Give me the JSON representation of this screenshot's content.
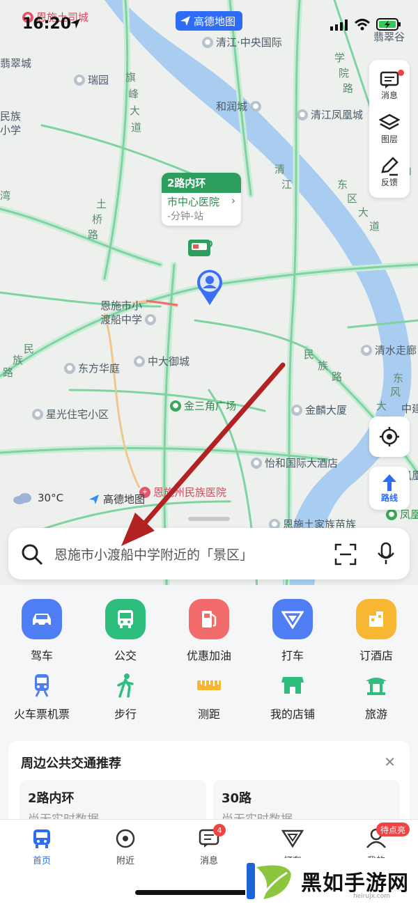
{
  "status_bar": {
    "time": "16:20"
  },
  "map": {
    "brand_pill": "高德地图",
    "pois": [
      {
        "name": "恩施土司城",
        "kind": "red"
      },
      {
        "name": "清江·中央国际",
        "kind": "gray"
      },
      {
        "name": "翡翠谷",
        "kind": "gray"
      },
      {
        "name": "翡翠城",
        "kind": "gray"
      },
      {
        "name": "瑞园",
        "kind": "gray"
      },
      {
        "name": "和润城",
        "kind": "gray"
      },
      {
        "name": "清江凤凰城",
        "kind": "gray"
      },
      {
        "name": "民族",
        "kind": "gray"
      },
      {
        "name": "小学",
        "kind": "gray"
      },
      {
        "name": "恩施市小",
        "kind": "gray"
      },
      {
        "name": "渡船中学",
        "kind": "gray"
      },
      {
        "name": "东方华庭",
        "kind": "gray"
      },
      {
        "name": "中大御城",
        "kind": "gray"
      },
      {
        "name": "清水走廊",
        "kind": "gray"
      },
      {
        "name": "金三角广场",
        "kind": "green"
      },
      {
        "name": "星光住宅小区",
        "kind": "gray"
      },
      {
        "name": "金麟大厦",
        "kind": "gray"
      },
      {
        "name": "中建",
        "kind": "gray"
      },
      {
        "name": "怡和国际大酒店",
        "kind": "gray"
      },
      {
        "name": "凤凰",
        "kind": "gray"
      },
      {
        "name": "恩施州民族医院",
        "kind": "red"
      },
      {
        "name": "凤凰",
        "kind": "green"
      },
      {
        "name": "恩施土家族苗族",
        "kind": "gray"
      }
    ],
    "road_labels": [
      "旗",
      "峰",
      "大",
      "道",
      "学",
      "院",
      "路",
      "清",
      "江",
      "东",
      "区",
      "大",
      "道",
      "土",
      "桥",
      "路",
      "民",
      "族",
      "路",
      "民",
      "族",
      "路",
      "东",
      "风",
      "大",
      "道",
      "山",
      "湾"
    ],
    "bus_card": {
      "line": "2路内环",
      "station": "市中心医院",
      "time": "-分钟-站"
    },
    "weather": "30°C",
    "logo_text": "高德地图"
  },
  "right_panel": {
    "items": [
      {
        "label": "消息",
        "icon": "message-icon"
      },
      {
        "label": "图层",
        "icon": "layers-icon"
      },
      {
        "label": "反馈",
        "icon": "feedback-icon"
      }
    ],
    "locate_icon": "locate-icon",
    "route_label": "路线"
  },
  "search": {
    "placeholder": "恩施市小渡船中学附近的「景区」"
  },
  "services_row1": [
    {
      "label": "驾车",
      "color": "#4f7df4"
    },
    {
      "label": "公交",
      "color": "#2dbd7c"
    },
    {
      "label": "优惠加油",
      "color": "#f26b6b"
    },
    {
      "label": "打车",
      "color": "#4f7df4"
    },
    {
      "label": "订酒店",
      "color": "#f7b733"
    }
  ],
  "services_row2": [
    {
      "label": "火车票机票"
    },
    {
      "label": "步行"
    },
    {
      "label": "测距"
    },
    {
      "label": "我的店铺"
    },
    {
      "label": "旅游"
    }
  ],
  "transit": {
    "title": "周边公共交通推荐",
    "routes": [
      {
        "name": "2路内环",
        "status": "尚无实时数据"
      },
      {
        "name": "30路",
        "status": "尚无实时数据"
      }
    ]
  },
  "tabbar": {
    "tabs": [
      {
        "label": "首页"
      },
      {
        "label": "附近"
      },
      {
        "label": "消息",
        "badge": "4"
      },
      {
        "label": "打车"
      },
      {
        "label": "我的",
        "badge": "待点亮"
      }
    ]
  },
  "watermark": {
    "text": "黑如手游网",
    "url": "heirujx.com"
  }
}
